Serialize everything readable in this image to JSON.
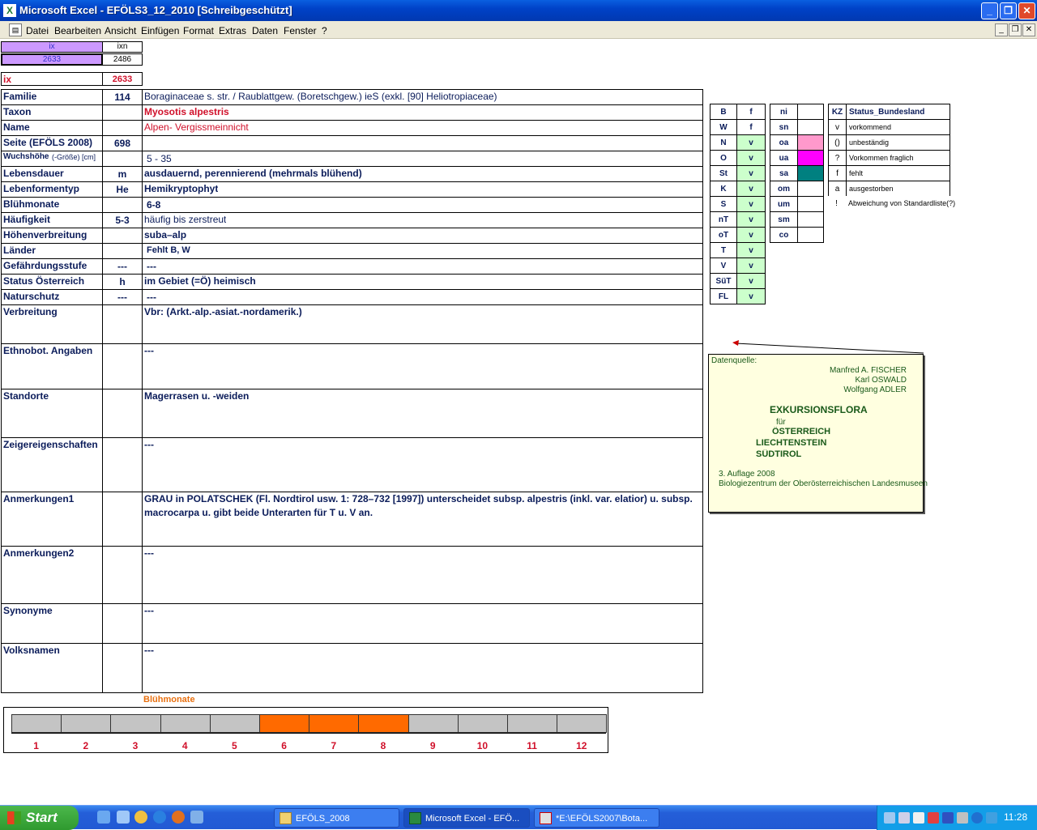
{
  "window": {
    "title": "Microsoft Excel - EFÖLS3_12_2010  [Schreibgeschützt]",
    "app_icon": "excel-icon",
    "btn_minimize": "_",
    "btn_restore": "❐",
    "btn_close": "✕"
  },
  "menu": [
    "Datei",
    "Bearbeiten",
    "Ansicht",
    "Einfügen",
    "Format",
    "Extras",
    "Daten",
    "Fenster",
    "?"
  ],
  "header_cells": {
    "ix_label": "ix",
    "ixn_label": "ixn",
    "ix_value": "2633",
    "ixn_value": "2486",
    "ix_big_label": "ix",
    "ix_big_value": "2633"
  },
  "fields": [
    {
      "label": "Familie",
      "code": "114",
      "value": "Boraginaceae s. str.  /  Raublattgew. (Boretschgew.) ieS (exkl. [90] Heliotropiaceae)"
    },
    {
      "label": "Taxon",
      "code": "",
      "value": "Myosotis alpestris"
    },
    {
      "label": "Name",
      "code": "",
      "value": "Alpen- Vergissmeinnicht"
    },
    {
      "label": "Seite (EFÖLS 2008)",
      "code": "698",
      "value": ""
    },
    {
      "label": "Wuchshöhe",
      "label2": "(-Größe) [cm]",
      "code": "",
      "value": "5 - 35"
    },
    {
      "label": "Lebensdauer",
      "code": "m",
      "value": "ausdauernd, perennierend (mehrmals blühend)"
    },
    {
      "label": "Lebenformentyp",
      "code": "He",
      "value": "Hemikryptophyt"
    },
    {
      "label": "Blühmonate",
      "code": "",
      "value": "6-8"
    },
    {
      "label": "Häufigkeit",
      "code": "5-3",
      "value": "häufig bis zerstreut"
    },
    {
      "label": "Höhenverbreitung",
      "code": "",
      "value": "suba–alp"
    },
    {
      "label": "Länder",
      "code": "",
      "value": "Fehlt B, W"
    },
    {
      "label": "Gefährdungsstufe",
      "code": "---",
      "value": "---"
    },
    {
      "label": "Status Österreich",
      "code": "h",
      "value": "im Gebiet (=Ö) heimisch"
    },
    {
      "label": "Naturschutz",
      "code": "---",
      "value": "---"
    },
    {
      "label": "Verbreitung",
      "code": "",
      "value": "Vbr: (Arkt.-alp.-asiat.-nordamerik.)"
    },
    {
      "label": "Ethnobot. Angaben",
      "code": "",
      "value": "---"
    },
    {
      "label": "Standorte",
      "code": "",
      "value": "Magerrasen u. -weiden"
    },
    {
      "label": "Zeigereigenschaften",
      "code": "",
      "value": "---"
    },
    {
      "label": "Anmerkungen1",
      "code": "",
      "value": "GRAU in POLATSCHEK (Fl. Nordtirol usw. 1: 728–732 [1997]) unterscheidet subsp. alpestris (inkl. var. elatior) u. subsp.",
      "value2": "macrocarpa u. gibt beide Unterarten für T u. V an."
    },
    {
      "label": "Anmerkungen2",
      "code": "",
      "value": "---"
    },
    {
      "label": "Synonyme",
      "code": "",
      "value": "---"
    },
    {
      "label": "Volksnamen",
      "code": "",
      "value": "---"
    }
  ],
  "states": [
    [
      "B",
      "f"
    ],
    [
      "W",
      "f"
    ],
    [
      "N",
      "v"
    ],
    [
      "O",
      "v"
    ],
    [
      "St",
      "v"
    ],
    [
      "K",
      "v"
    ],
    [
      "S",
      "v"
    ],
    [
      "nT",
      "v"
    ],
    [
      "oT",
      "v"
    ],
    [
      "T",
      "v"
    ],
    [
      "V",
      "v"
    ],
    [
      "SüT",
      "v"
    ],
    [
      "FL",
      "v"
    ]
  ],
  "zones": [
    "ni",
    "sn",
    "oa",
    "ua",
    "sa",
    "om",
    "um",
    "sm",
    "co"
  ],
  "zone_colors": {
    "oa": "#ff99cc",
    "ua": "#ff00ff",
    "sa": "#008080"
  },
  "legend": {
    "header_kz": "KZ",
    "header_status": "Status_Bundesland",
    "rows": [
      [
        "v",
        "vorkommend"
      ],
      [
        "()",
        "unbeständig"
      ],
      [
        "?",
        "Vorkommen fraglich"
      ],
      [
        "f",
        "fehlt"
      ],
      [
        "a",
        "ausgestorben"
      ],
      [
        "!",
        "Abweichung von Standardliste(?)"
      ]
    ]
  },
  "note": {
    "source_label": "Datenquelle:",
    "authors": [
      "Manfred A. FISCHER",
      "Karl OSWALD",
      "Wolfgang ADLER"
    ],
    "title": "EXKURSIONSFLORA",
    "fuer": "für",
    "countries": [
      "ÖSTERREICH",
      "LIECHTENSTEIN",
      "SÜDTIROL"
    ],
    "edition": "3. Auflage 2008",
    "publisher": "Biologiezentrum der Oberösterreichischen Landesmuseen"
  },
  "chart_data": {
    "type": "bar",
    "title": "Blühmonate",
    "categories": [
      "1",
      "2",
      "3",
      "4",
      "5",
      "6",
      "7",
      "8",
      "9",
      "10",
      "11",
      "12"
    ],
    "values": [
      0,
      0,
      0,
      0,
      0,
      1,
      1,
      1,
      0,
      0,
      0,
      0
    ],
    "colors": {
      "on": "#ff6a00",
      "off": "#c4c4c4"
    }
  },
  "taskbar": {
    "start": "Start",
    "items": [
      "EFÖLS_2008",
      "Microsoft Excel - EFÖ...",
      "*E:\\EFÖLS2007\\Bota..."
    ],
    "clock": "11:28"
  }
}
